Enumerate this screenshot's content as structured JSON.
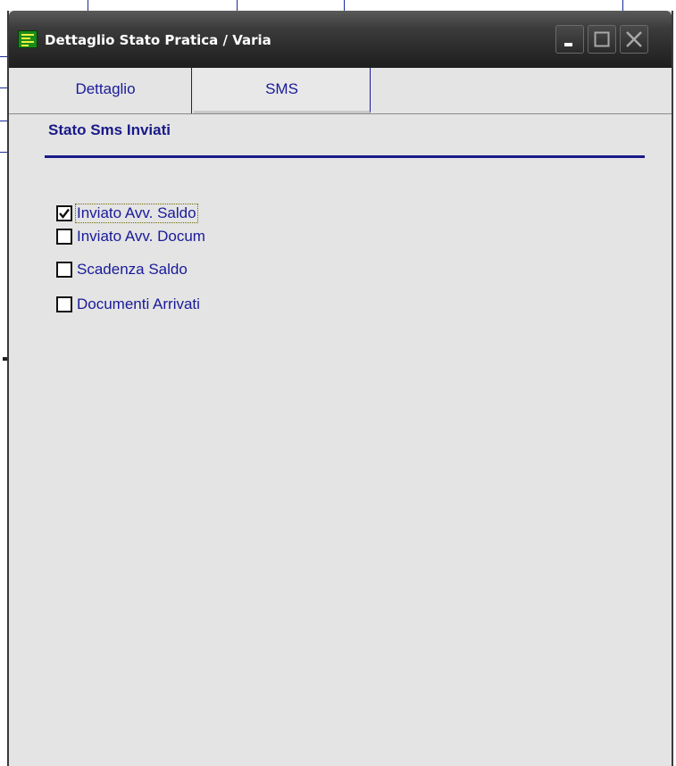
{
  "window": {
    "title": "Dettaglio Stato Pratica / Varia"
  },
  "tabs": [
    {
      "label": "Dettaglio",
      "selected": false
    },
    {
      "label": "SMS",
      "selected": true
    }
  ],
  "section": {
    "title": "Stato Sms Inviati"
  },
  "checkboxes": [
    {
      "label": "Inviato Avv. Saldo",
      "checked": true,
      "focused": true
    },
    {
      "label": "Inviato Avv. Docum",
      "checked": false,
      "focused": false
    },
    {
      "label": "Scadenza Saldo",
      "checked": false,
      "focused": false
    },
    {
      "label": "Documenti Arrivati",
      "checked": false,
      "focused": false
    }
  ],
  "colors": {
    "label_text": "#1a1a9a",
    "section_rule": "#1a1a8a",
    "window_bg": "#e4e4e4",
    "titlebar": "#2a2a2a"
  },
  "icons": {
    "app": "app-icon",
    "minimize": "minimize-icon",
    "maximize": "maximize-icon",
    "close": "close-icon",
    "check": "checkmark-icon"
  }
}
